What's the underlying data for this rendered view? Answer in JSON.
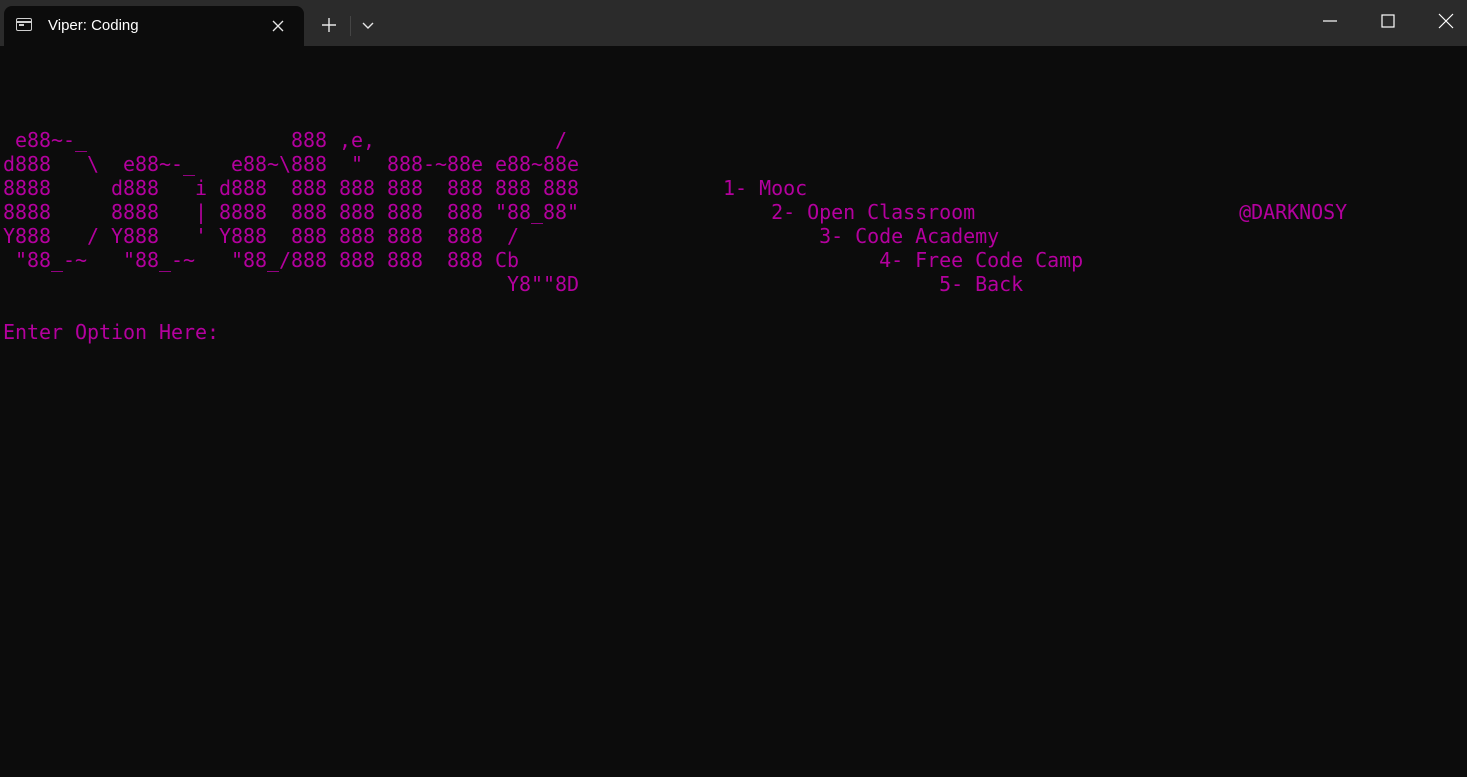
{
  "window": {
    "tab_title": "Viper: Coding",
    "icons": {
      "tab": "terminal-icon",
      "tab_close": "close-icon",
      "new_tab": "plus-icon",
      "dropdown": "chevron-down-icon",
      "minimize": "minimize-icon",
      "maximize": "maximize-icon",
      "close": "close-icon"
    }
  },
  "terminal": {
    "text_color": "#b4009e",
    "background": "#0c0c0c",
    "lines": [
      " e88~-_                 888 ,e,               /",
      "d888   \\  e88~-_   e88~\\888  \"  888-~88e e88~88e",
      "8888     d888   i d888  888 888 888  888 888 888            1- Mooc",
      "8888     8888   | 8888  888 888 888  888 \"88_88\"                2- Open Classroom                      @DARKNOSY",
      "Y888   / Y888   ' Y888  888 888 888  888  /                         3- Code Academy",
      " \"88_-~   \"88_-~   \"88_/888 888 888  888 Cb                              4- Free Code Camp",
      "                                          Y8\"\"8D                              5- Back",
      "",
      "Enter Option Here:"
    ]
  }
}
